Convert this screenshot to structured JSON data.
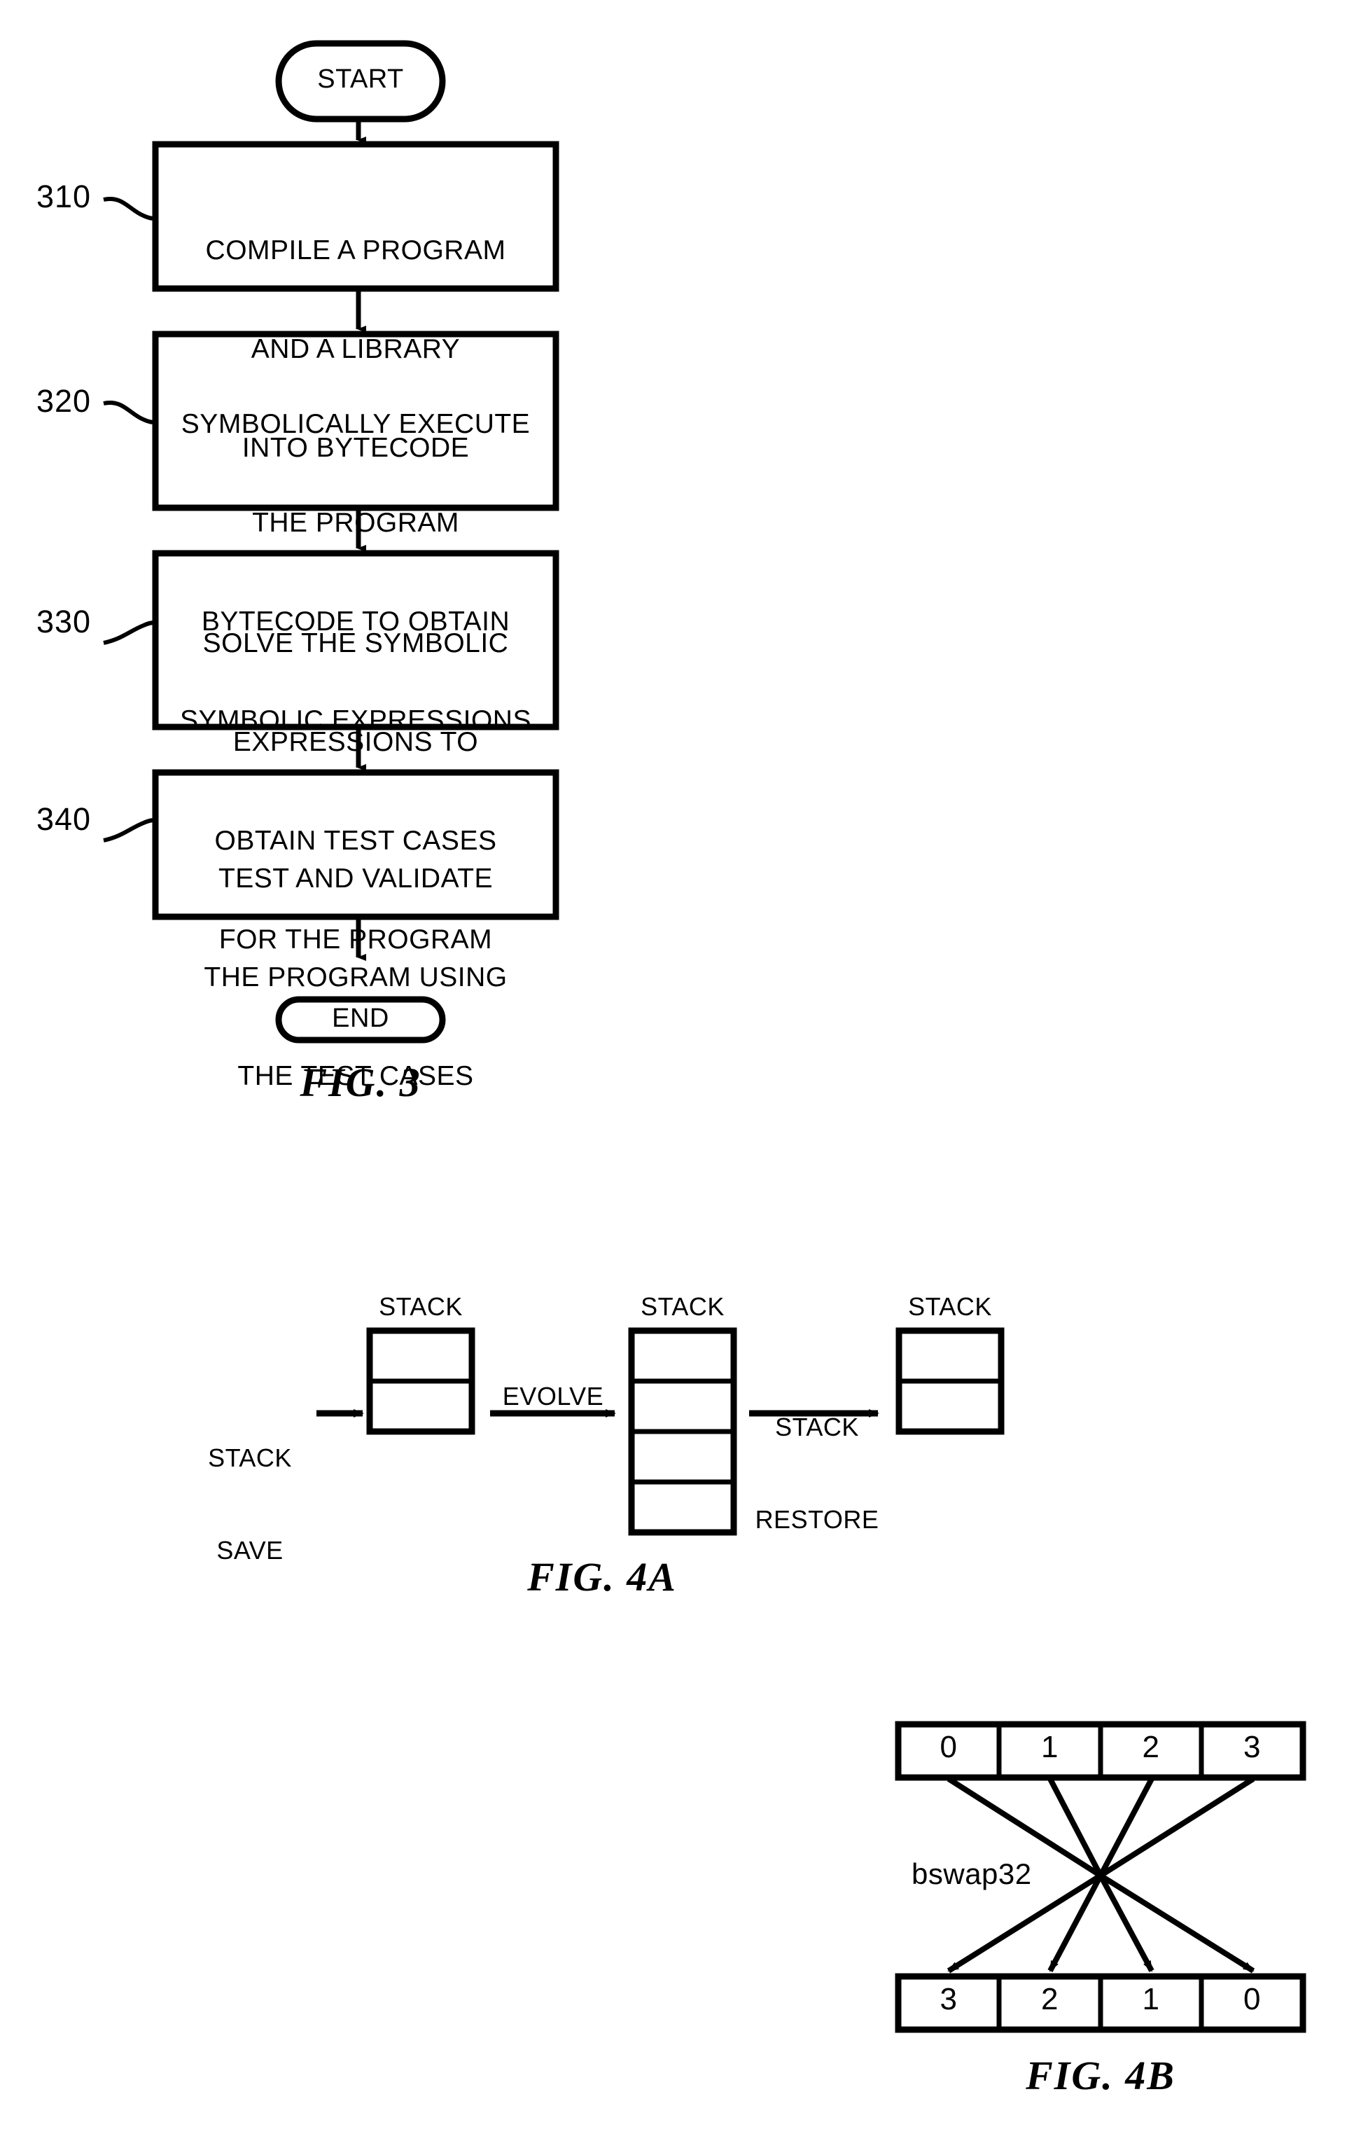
{
  "figures": [
    {
      "id": "fig3",
      "caption": "FIG. 3",
      "start_label": "START",
      "end_label": "END",
      "steps": [
        {
          "ref": "310",
          "lines": [
            "COMPILE A PROGRAM",
            "AND A LIBRARY",
            "INTO BYTECODE"
          ]
        },
        {
          "ref": "320",
          "lines": [
            "SYMBOLICALLY EXECUTE",
            "THE PROGRAM",
            "BYTECODE TO OBTAIN",
            "SYMBOLIC EXPRESSIONS"
          ]
        },
        {
          "ref": "330",
          "lines": [
            "SOLVE THE SYMBOLIC",
            "EXPRESSIONS TO",
            "OBTAIN TEST CASES",
            "FOR THE PROGRAM"
          ]
        },
        {
          "ref": "340",
          "lines": [
            "TEST AND VALIDATE",
            "THE PROGRAM USING",
            "THE TEST CASES"
          ]
        }
      ]
    },
    {
      "id": "fig4a",
      "caption": "FIG. 4A",
      "input_label_lines": [
        "STACK",
        "SAVE"
      ],
      "stacks": [
        {
          "title": "STACK",
          "cells": 2
        },
        {
          "title": "STACK",
          "cells": 4
        },
        {
          "title": "STACK",
          "cells": 2
        }
      ],
      "transitions": [
        {
          "lines": [
            "EVOLVE"
          ]
        },
        {
          "lines": [
            "STACK",
            "RESTORE"
          ]
        }
      ]
    },
    {
      "id": "fig4b",
      "caption": "FIG. 4B",
      "operation_label": "bswap32",
      "input_row": [
        "0",
        "1",
        "2",
        "3"
      ],
      "output_row": [
        "3",
        "2",
        "1",
        "0"
      ],
      "mapping": [
        {
          "from": 0,
          "to": 3
        },
        {
          "from": 1,
          "to": 2
        },
        {
          "from": 2,
          "to": 1
        },
        {
          "from": 3,
          "to": 0
        }
      ]
    }
  ],
  "style": {
    "ink": "#000000",
    "paper": "#ffffff"
  }
}
